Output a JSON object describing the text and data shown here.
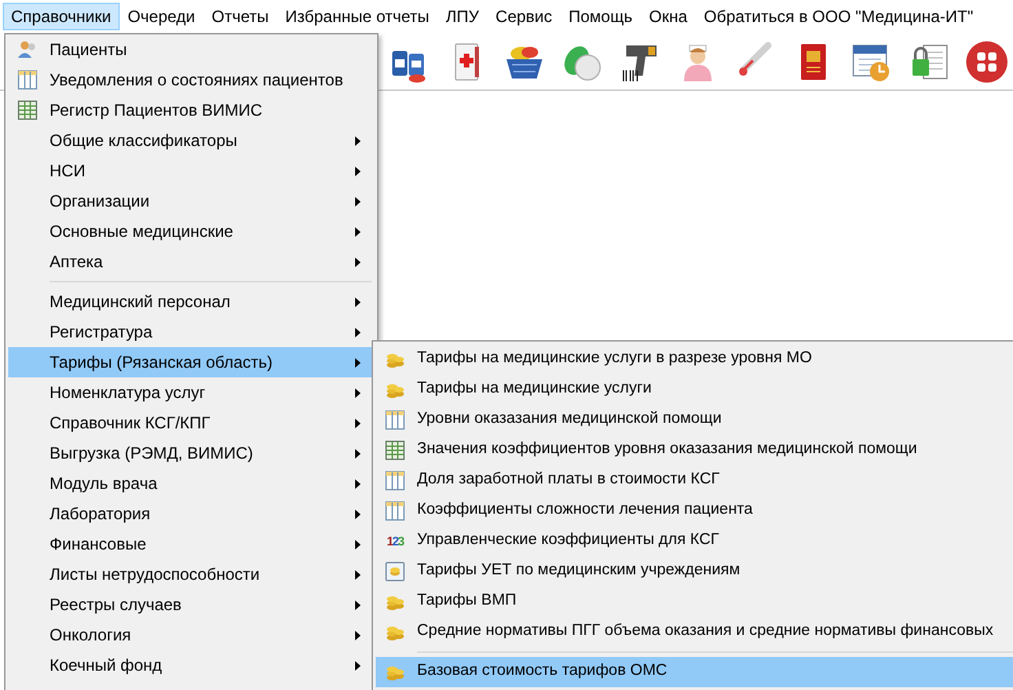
{
  "menu_bar": [
    {
      "label": "Справочники",
      "selected": true
    },
    {
      "label": "Очереди",
      "selected": false
    },
    {
      "label": "Отчеты",
      "selected": false
    },
    {
      "label": "Избранные отчеты",
      "selected": false
    },
    {
      "label": "ЛПУ",
      "selected": false
    },
    {
      "label": "Сервис",
      "selected": false
    },
    {
      "label": "Помощь",
      "selected": false
    },
    {
      "label": "Окна",
      "selected": false
    },
    {
      "label": "Обратиться в ООО \"Медицина-ИТ\"",
      "selected": false
    }
  ],
  "menu": {
    "groups": [
      [
        {
          "label": "Пациенты",
          "kind": "person",
          "submenu": false,
          "selected": false
        },
        {
          "label": "Уведомления о состояниях пациентов",
          "kind": "columns",
          "submenu": false,
          "selected": false
        },
        {
          "label": "Регистр Пациентов ВИМИС",
          "kind": "grid",
          "submenu": false,
          "selected": false
        },
        {
          "label": "Общие классификаторы",
          "submenu": true,
          "selected": false
        },
        {
          "label": "НСИ",
          "submenu": true,
          "selected": false
        },
        {
          "label": "Организации",
          "submenu": true,
          "selected": false
        },
        {
          "label": "Основные медицинские",
          "submenu": true,
          "selected": false
        },
        {
          "label": "Аптека",
          "submenu": true,
          "selected": false
        }
      ],
      [
        {
          "label": "Медицинский персонал",
          "submenu": true,
          "selected": false
        },
        {
          "label": "Регистратура",
          "submenu": true,
          "selected": false
        },
        {
          "label": "Тарифы (Рязанская область)",
          "submenu": true,
          "selected": true
        },
        {
          "label": "Номенклатура услуг",
          "submenu": true,
          "selected": false
        },
        {
          "label": "Справочник КСГ/КПГ",
          "submenu": true,
          "selected": false
        },
        {
          "label": "Выгрузка (РЭМД, ВИМИС)",
          "submenu": true,
          "selected": false
        },
        {
          "label": "Модуль врача",
          "submenu": true,
          "selected": false
        },
        {
          "label": "Лаборатория",
          "submenu": true,
          "selected": false
        },
        {
          "label": "Финансовые",
          "submenu": true,
          "selected": false
        },
        {
          "label": "Листы нетрудоспособности",
          "submenu": true,
          "selected": false
        },
        {
          "label": "Реестры случаев",
          "submenu": true,
          "selected": false
        },
        {
          "label": "Онкология",
          "submenu": true,
          "selected": false
        },
        {
          "label": "Коечный фонд",
          "submenu": true,
          "selected": false
        }
      ]
    ]
  },
  "submenu": {
    "groups": [
      [
        {
          "label": "Тарифы на медицинские услуги в разрезе уровня МО",
          "kind": "coins",
          "selected": false
        },
        {
          "label": "Тарифы на медицинские услуги",
          "kind": "coins",
          "selected": false
        },
        {
          "label": "Уровни оказазания медицинской помощи",
          "kind": "columns",
          "selected": false
        },
        {
          "label": "Значения коэффициентов уровня оказазания медицинской помощи",
          "kind": "grid",
          "selected": false
        },
        {
          "label": "Доля заработной платы в стоимости КСГ",
          "kind": "columns",
          "selected": false
        },
        {
          "label": "Коэффициенты сложности лечения пациента",
          "kind": "columns",
          "selected": false
        },
        {
          "label": "Управленческие коэффициенты для КСГ",
          "kind": "digits",
          "icon_text": "123",
          "selected": false
        },
        {
          "label": "Тарифы УЕТ по медицинским учреждениям",
          "kind": "coin-card",
          "selected": false
        },
        {
          "label": "Тарифы ВМП",
          "kind": "coins",
          "selected": false
        },
        {
          "label": "Средние нормативы ПГГ объема оказания и средние нормативы финансовых",
          "kind": "coins",
          "selected": false
        }
      ],
      [
        {
          "label": "Базовая стоимость тарифов ОМС",
          "kind": "coins",
          "selected": true
        }
      ]
    ]
  }
}
